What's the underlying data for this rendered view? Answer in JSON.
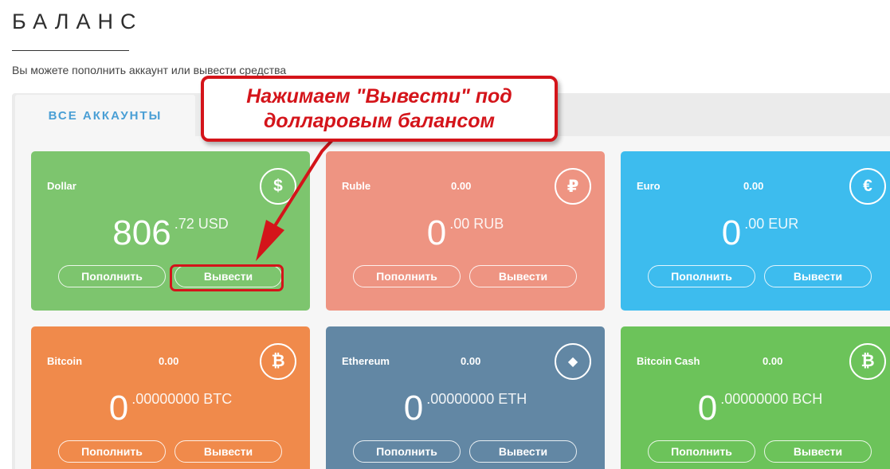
{
  "header": {
    "title": "БАЛАНС",
    "subtitle": "Вы можете пополнить аккаунт или вывести средства"
  },
  "tabs": {
    "active_label": "ВСЕ АККАУНТЫ"
  },
  "annotation": {
    "callout_text": "Нажимаем \"Вывести\" под\nдолларовым балансом",
    "color": "#d4141a"
  },
  "cards": [
    {
      "name": "Dollar",
      "small_balance": "",
      "icon": "dollar-icon",
      "symbol": "$",
      "int": "806",
      "dec": ".72 USD",
      "topup": "Пополнить",
      "withdraw": "Вывести",
      "color": "#7dc56e"
    },
    {
      "name": "Ruble",
      "small_balance": "0.00",
      "icon": "ruble-icon",
      "symbol": "₽",
      "int": "0",
      "dec": ".00 RUB",
      "topup": "Пополнить",
      "withdraw": "Вывести",
      "color": "#ee9482"
    },
    {
      "name": "Euro",
      "small_balance": "0.00",
      "icon": "euro-icon",
      "symbol": "€",
      "int": "0",
      "dec": ".00 EUR",
      "topup": "Пополнить",
      "withdraw": "Вывести",
      "color": "#3dbcee"
    },
    {
      "name": "Bitcoin",
      "small_balance": "0.00",
      "icon": "bitcoin-icon",
      "symbol": "₿",
      "int": "0",
      "dec": ".00000000 BTC",
      "topup": "Пополнить",
      "withdraw": "Вывести",
      "color": "#f08a4b"
    },
    {
      "name": "Ethereum",
      "small_balance": "0.00",
      "icon": "ethereum-icon",
      "symbol": "◆",
      "int": "0",
      "dec": ".00000000 ETH",
      "topup": "Пополнить",
      "withdraw": "Вывести",
      "color": "#6287a4"
    },
    {
      "name": "Bitcoin Cash",
      "small_balance": "0.00",
      "icon": "bitcoin-cash-icon",
      "symbol": "₿",
      "int": "0",
      "dec": ".00000000 BCH",
      "topup": "Пополнить",
      "withdraw": "Вывести",
      "color": "#6cc35a"
    }
  ]
}
